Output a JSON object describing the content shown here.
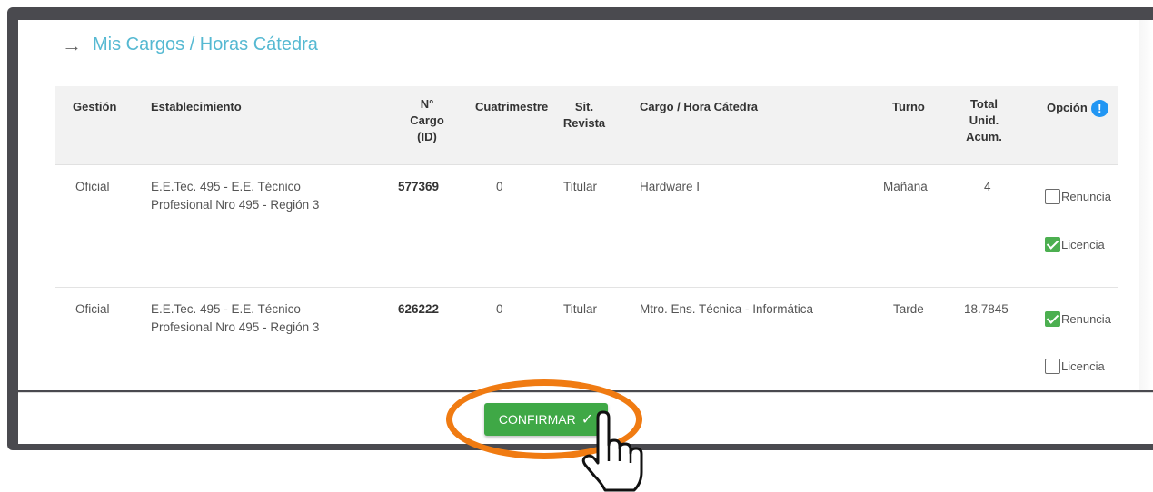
{
  "title": "Mis Cargos / Horas Cátedra",
  "columns": {
    "gestion": "Gestión",
    "establecimiento": "Establecimiento",
    "cargo_id": [
      "N°",
      "Cargo",
      "(ID)"
    ],
    "cuatrimestre": "Cuatrimestre",
    "sit_revista": [
      "Sit.",
      "Revista"
    ],
    "cargo_hora": "Cargo / Hora Cátedra",
    "turno": "Turno",
    "total": [
      "Total",
      "Unid.",
      "Acum."
    ],
    "opcion": "Opción"
  },
  "rows": [
    {
      "gestion": "Oficial",
      "establecimiento": [
        "E.E.Tec. 495 - E.E. Técnico",
        "Profesional Nro 495 - Región 3"
      ],
      "cargo_id": "577369",
      "cuatrimestre": "0",
      "sit_revista": "Titular",
      "cargo_hora": "Hardware I",
      "turno": "Mañana",
      "total": "4",
      "renuncia_label": "Renuncia",
      "renuncia_checked": false,
      "licencia_label": "Licencia",
      "licencia_checked": true
    },
    {
      "gestion": "Oficial",
      "establecimiento": [
        "E.E.Tec. 495 - E.E. Técnico",
        "Profesional Nro 495 - Región 3"
      ],
      "cargo_id": "626222",
      "cuatrimestre": "0",
      "sit_revista": "Titular",
      "cargo_hora": "Mtro. Ens. Técnica - Informática",
      "turno": "Tarde",
      "total": "18.7845",
      "renuncia_label": "Renuncia",
      "renuncia_checked": true,
      "licencia_label": "Licencia",
      "licencia_checked": false
    }
  ],
  "confirm_button": "CONFIRMAR",
  "info_icon_glyph": "!",
  "colors": {
    "accent_title": "#56b9d2",
    "confirm_green": "#3fa846",
    "highlight_orange": "#f07b12",
    "checkbox_green": "#4caf50",
    "info_blue": "#2196f3"
  }
}
